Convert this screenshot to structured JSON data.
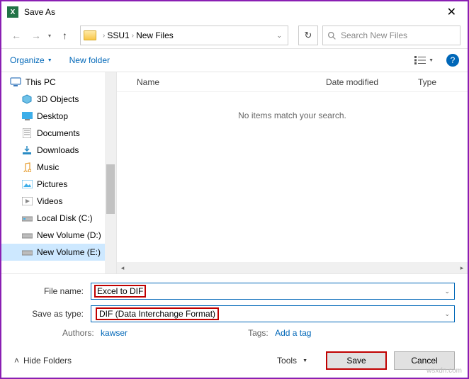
{
  "window": {
    "title": "Save As"
  },
  "breadcrumb": {
    "seg1": "SSU1",
    "seg2": "New Files"
  },
  "search": {
    "placeholder": "Search New Files"
  },
  "toolbar": {
    "organize": "Organize",
    "newfolder": "New folder"
  },
  "tree": {
    "thispc": "This PC",
    "objects3d": "3D Objects",
    "desktop": "Desktop",
    "documents": "Documents",
    "downloads": "Downloads",
    "music": "Music",
    "pictures": "Pictures",
    "videos": "Videos",
    "localc": "Local Disk (C:)",
    "vold": "New Volume (D:)",
    "vole": "New Volume (E:)"
  },
  "columns": {
    "name": "Name",
    "date": "Date modified",
    "type": "Type"
  },
  "content": {
    "empty": "No items match your search."
  },
  "form": {
    "filename_label": "File name:",
    "filename_value": "Excel to DIF",
    "type_label": "Save as type:",
    "type_value": "DIF (Data Interchange Format)",
    "authors_label": "Authors:",
    "authors_value": "kawser",
    "tags_label": "Tags:",
    "tags_value": "Add a tag"
  },
  "footer": {
    "hide": "Hide Folders",
    "tools": "Tools",
    "save": "Save",
    "cancel": "Cancel"
  },
  "watermark": "wsxdn.com"
}
